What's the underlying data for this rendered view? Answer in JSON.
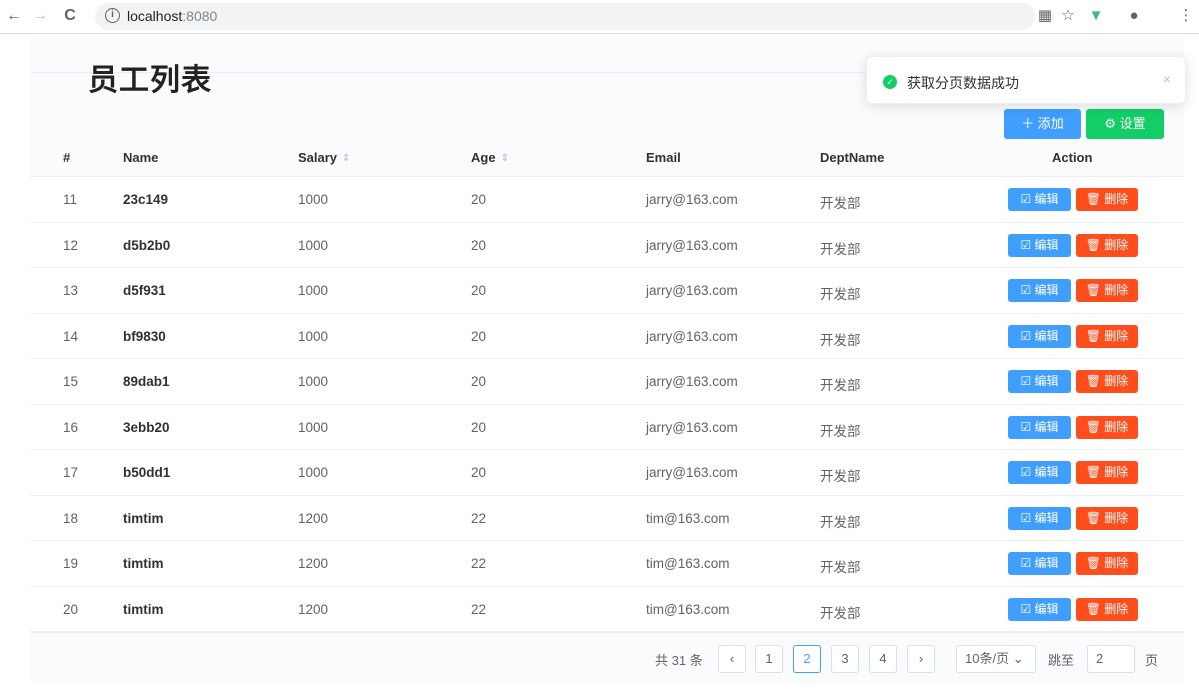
{
  "browser": {
    "url_host": "localhost",
    "url_port": ":8080",
    "back_icon": "←",
    "forward_icon": "→",
    "reload_icon": "C",
    "info_icon": "i"
  },
  "page": {
    "title": "员工列表",
    "add_label": "＋ 添加",
    "settings_label": "⚙ 设置"
  },
  "notification": {
    "message": "获取分页数据成功",
    "close": "×",
    "color": "#13ce66"
  },
  "table": {
    "headers": {
      "index": "#",
      "name": "Name",
      "salary": "Salary",
      "age": "Age",
      "email": "Email",
      "dept": "DeptName",
      "action": "Action"
    },
    "edit_label": "☑ 编辑",
    "delete_label": "🗑 删除",
    "rows": [
      {
        "id": "11",
        "name": "23c149",
        "salary": "1000",
        "age": "20",
        "email": "jarry@163.com",
        "dept": "开发部"
      },
      {
        "id": "12",
        "name": "d5b2b0",
        "salary": "1000",
        "age": "20",
        "email": "jarry@163.com",
        "dept": "开发部"
      },
      {
        "id": "13",
        "name": "d5f931",
        "salary": "1000",
        "age": "20",
        "email": "jarry@163.com",
        "dept": "开发部"
      },
      {
        "id": "14",
        "name": "bf9830",
        "salary": "1000",
        "age": "20",
        "email": "jarry@163.com",
        "dept": "开发部"
      },
      {
        "id": "15",
        "name": "89dab1",
        "salary": "1000",
        "age": "20",
        "email": "jarry@163.com",
        "dept": "开发部"
      },
      {
        "id": "16",
        "name": "3ebb20",
        "salary": "1000",
        "age": "20",
        "email": "jarry@163.com",
        "dept": "开发部"
      },
      {
        "id": "17",
        "name": "b50dd1",
        "salary": "1000",
        "age": "20",
        "email": "jarry@163.com",
        "dept": "开发部"
      },
      {
        "id": "18",
        "name": "timtim",
        "salary": "1200",
        "age": "22",
        "email": "tim@163.com",
        "dept": "开发部"
      },
      {
        "id": "19",
        "name": "timtim",
        "salary": "1200",
        "age": "22",
        "email": "tim@163.com",
        "dept": "开发部"
      },
      {
        "id": "20",
        "name": "timtim",
        "salary": "1200",
        "age": "22",
        "email": "tim@163.com",
        "dept": "开发部"
      }
    ]
  },
  "pagination": {
    "total": "共 31 条",
    "prev": "‹",
    "next": "›",
    "pages": [
      "1",
      "2",
      "3",
      "4"
    ],
    "current": "2",
    "page_size": "10条/页",
    "jump_label": "跳至",
    "jump_value": "2",
    "page_suffix": "页"
  },
  "colors": {
    "primary": "#409eff",
    "success": "#13ce66",
    "danger": "#ff4d1c"
  }
}
